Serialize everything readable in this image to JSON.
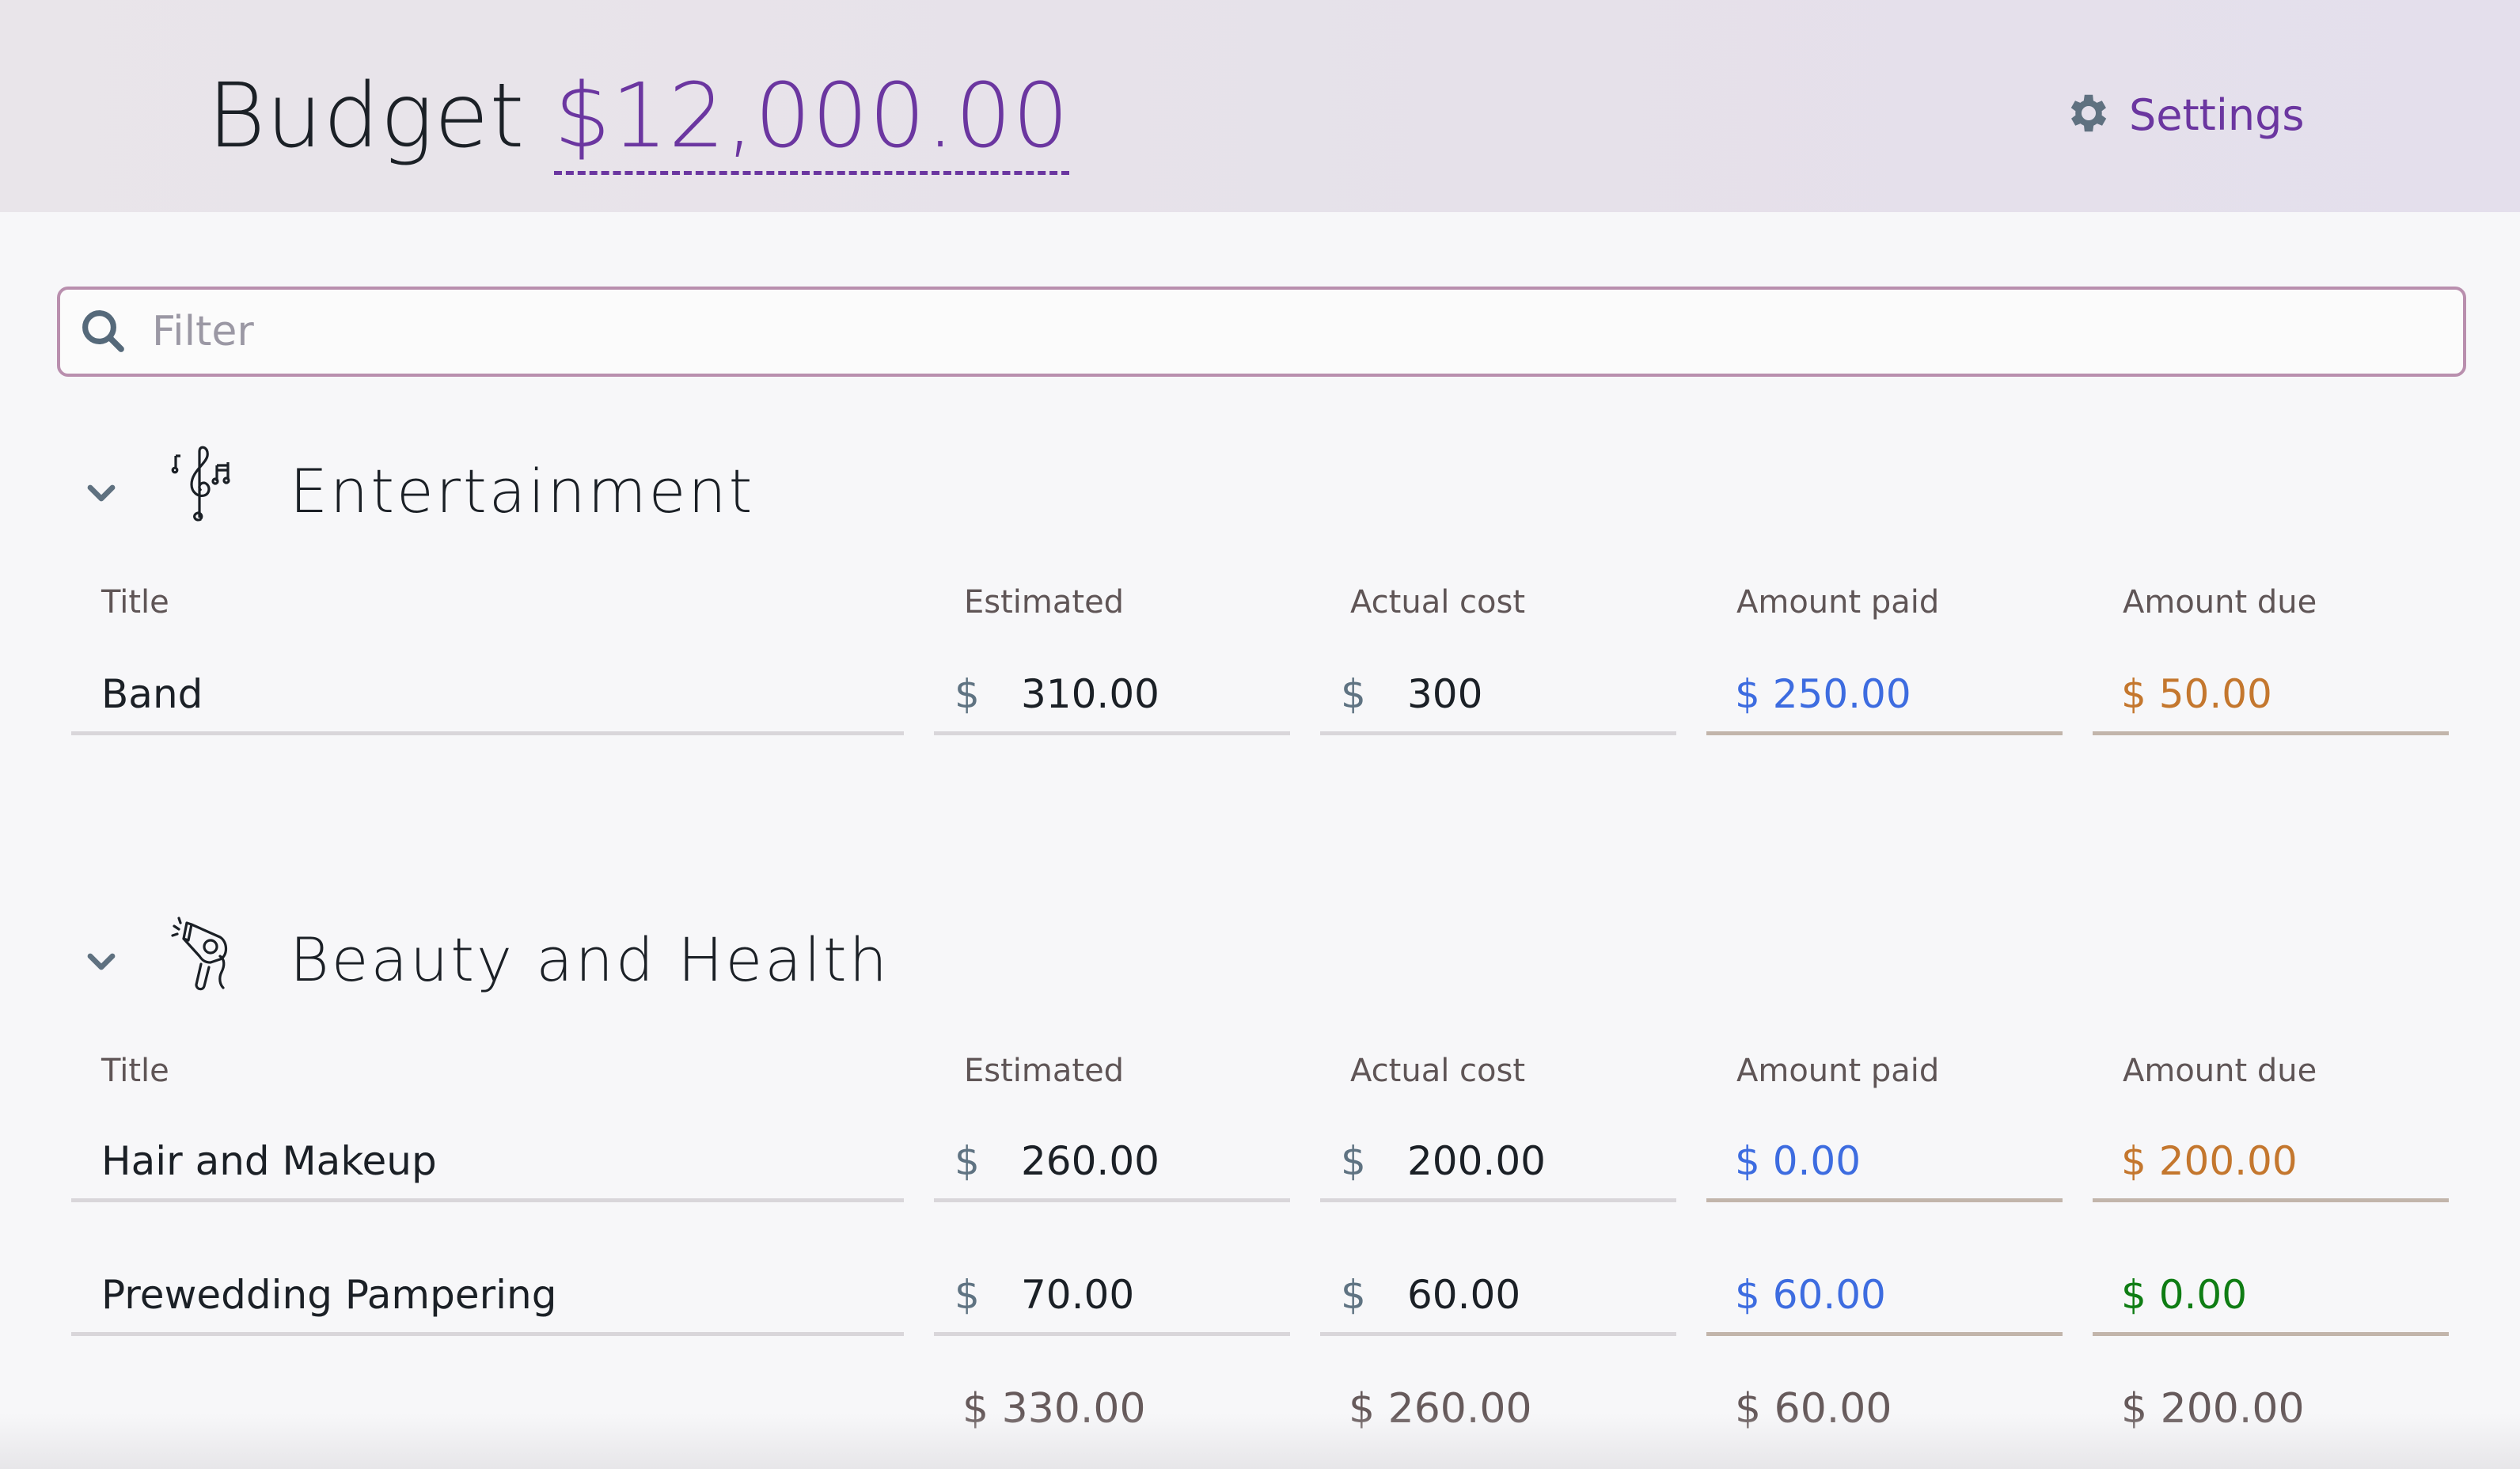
{
  "header": {
    "title": "Budget",
    "budget_amount": "$12,000.00",
    "settings_label": "Settings",
    "settings_icon": "gear-icon"
  },
  "filter": {
    "placeholder": "Filter",
    "value": "",
    "icon": "search-icon"
  },
  "columns": {
    "title": "Title",
    "estimated": "Estimated",
    "actual": "Actual cost",
    "paid": "Amount paid",
    "due": "Amount due"
  },
  "currency_symbol": "$",
  "colors": {
    "accent": "#6b36a0",
    "paid": "#3d6ce0",
    "due_outstanding": "#c4772e",
    "due_settled": "#0f7d14"
  },
  "categories": [
    {
      "name": "Entertainment",
      "icon": "music-notes-icon",
      "expanded": true,
      "items": [
        {
          "title": "Band",
          "estimated": "310.00",
          "actual": "300",
          "paid": "$ 250.00",
          "due": "$ 50.00",
          "due_status": "outstanding"
        }
      ]
    },
    {
      "name": "Beauty and Health",
      "icon": "hair-dryer-icon",
      "expanded": true,
      "items": [
        {
          "title": "Hair and Makeup",
          "estimated": "260.00",
          "actual": "200.00",
          "paid": "$ 0.00",
          "due": "$ 200.00",
          "due_status": "outstanding"
        },
        {
          "title": "Prewedding Pampering",
          "estimated": "70.00",
          "actual": "60.00",
          "paid": "$ 60.00",
          "due": "$ 0.00",
          "due_status": "settled"
        }
      ],
      "totals": {
        "estimated": "$ 330.00",
        "actual": "$ 260.00",
        "paid": "$ 60.00",
        "due": "$ 200.00"
      }
    }
  ]
}
